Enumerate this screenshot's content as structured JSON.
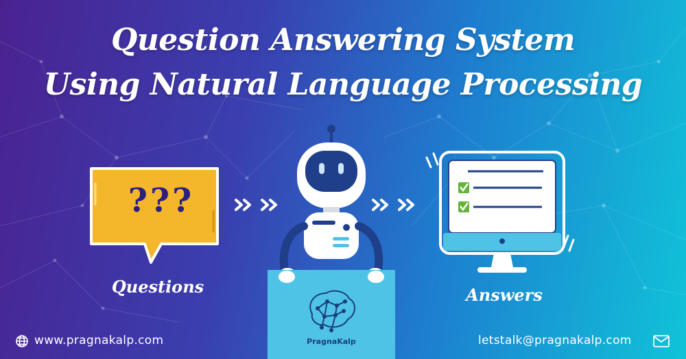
{
  "title": {
    "line1": "Question Answering System",
    "line2": "Using Natural Language Processing"
  },
  "questions": {
    "bubble_text": "???",
    "caption": "Questions"
  },
  "answers": {
    "caption": "Answers",
    "checklist_items": 2
  },
  "brand": {
    "name": "PragnaKalp"
  },
  "footer": {
    "website": "www.pragnakalp.com",
    "email": "letstalk@pragnakalp.com"
  },
  "icons": {
    "website": "globe-icon",
    "email": "envelope-icon",
    "questions": "speech-bubble-icon",
    "robot": "robot-icon",
    "answers": "monitor-checklist-icon",
    "arrows": "double-chevron-icon",
    "logo": "brain-network-icon"
  },
  "colors": {
    "bubble": "#f4b62a",
    "ink": "#2c1f84",
    "robot_dark": "#1f3f8a",
    "board": "#4fc3e6",
    "check": "#62b53a"
  }
}
